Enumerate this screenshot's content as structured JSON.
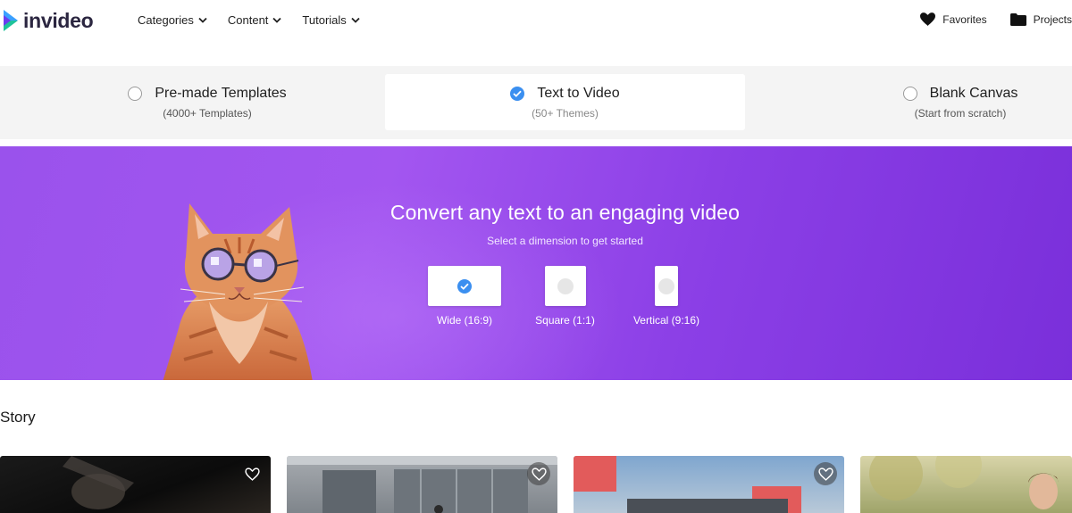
{
  "brand": {
    "name": "invideo"
  },
  "nav": {
    "items": [
      {
        "label": "Categories"
      },
      {
        "label": "Content"
      },
      {
        "label": "Tutorials"
      }
    ],
    "favorites_label": "Favorites",
    "projects_label": "Projects"
  },
  "modes": [
    {
      "title": "Pre-made Templates",
      "subtitle": "(4000+ Templates)",
      "selected": false
    },
    {
      "title": "Text to Video",
      "subtitle": "(50+ Themes)",
      "selected": true
    },
    {
      "title": "Blank Canvas",
      "subtitle": "(Start from scratch)",
      "selected": false
    }
  ],
  "hero": {
    "title": "Convert any text to an engaging video",
    "subtitle": "Select a dimension to get started",
    "dimensions": [
      {
        "label": "Wide (16:9)",
        "selected": true
      },
      {
        "label": "Square (1:1)",
        "selected": false
      },
      {
        "label": "Vertical (9:16)",
        "selected": false
      }
    ]
  },
  "story": {
    "title": "Story",
    "cards": [
      {
        "thumbnail": "dark-close-up"
      },
      {
        "thumbnail": "glass-building-entrance"
      },
      {
        "thumbnail": "street-with-red-sign"
      },
      {
        "thumbnail": "person-in-park"
      }
    ]
  },
  "colors": {
    "accent": "#3b8ff0",
    "hero_start": "#9a52ec",
    "hero_end": "#7a2fda",
    "brand_text": "#2b2640"
  }
}
